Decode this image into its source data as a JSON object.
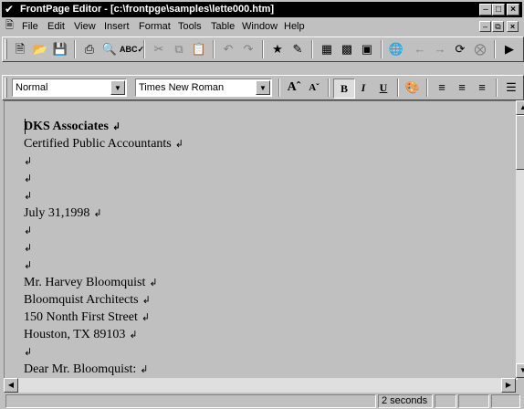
{
  "window": {
    "title": "FrontPage Editor - [c:\\frontpge\\samples\\lette000.htm]",
    "app_icon": "frontpage-icon",
    "controls": [
      "minimize",
      "maximize",
      "close"
    ]
  },
  "menubar": {
    "items": [
      "File",
      "Edit",
      "View",
      "Insert",
      "Format",
      "Tools",
      "Table",
      "Window",
      "Help"
    ],
    "mnemonics": [
      "F",
      "E",
      "V",
      "I",
      "o",
      "T",
      "a",
      "W",
      "H"
    ]
  },
  "toolbar_standard": {
    "icons": [
      "new-icon",
      "open-icon",
      "save-icon",
      "print-icon",
      "print-preview-icon",
      "spelling-icon",
      "cut-icon",
      "copy-icon",
      "paste-icon",
      "undo-icon",
      "redo-icon",
      "webbot-icon",
      "form-field-icon",
      "table-icon",
      "image-icon",
      "hyperlink-icon",
      "back-icon",
      "forward-icon",
      "refresh-icon",
      "stop-icon"
    ]
  },
  "toolbar_format": {
    "style_value": "Normal",
    "font_value": "Times New Roman",
    "buttons": [
      {
        "name": "increase-text-size",
        "glyph": "Aˆ"
      },
      {
        "name": "decrease-text-size",
        "glyph": "Aˇ"
      },
      {
        "name": "bold",
        "glyph": "B"
      },
      {
        "name": "italic",
        "glyph": "I"
      },
      {
        "name": "underline",
        "glyph": "U"
      }
    ],
    "icons": [
      "text-color-icon",
      "align-left-icon",
      "align-center-icon",
      "align-right-icon",
      "numbered-list-icon"
    ]
  },
  "document": {
    "paragraph_mark": "↲",
    "lines": [
      {
        "text": "DKS Associates",
        "bold": true
      },
      {
        "text": "Certified Public Accountants",
        "bold": false
      },
      {
        "text": "",
        "bold": false
      },
      {
        "text": "",
        "bold": false
      },
      {
        "text": "",
        "bold": false
      },
      {
        "text": "July 31,1998",
        "bold": false
      },
      {
        "text": "",
        "bold": false
      },
      {
        "text": "",
        "bold": false
      },
      {
        "text": "",
        "bold": false
      },
      {
        "text": "Mr. Harvey Bloomquist",
        "bold": false
      },
      {
        "text": "Bloomquist Architects",
        "bold": false
      },
      {
        "text": "150 Nonth First Street",
        "bold": false
      },
      {
        "text": "Houston, TX 89103",
        "bold": false
      },
      {
        "text": "",
        "bold": false
      },
      {
        "text": "Dear Mr. Bloomquist:",
        "bold": false
      }
    ]
  },
  "statusbar": {
    "load_time": "2 seconds"
  }
}
